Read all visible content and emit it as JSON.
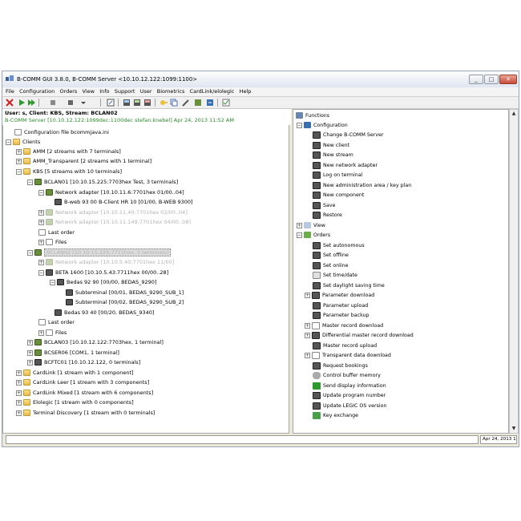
{
  "window": {
    "title": "B-COMM GUI 3.8.0, B-COMM Server <10.10.12.122:1099:1100>"
  },
  "menu": [
    "File",
    "Configuration",
    "Orders",
    "View",
    "Info",
    "Support",
    "User",
    "Biometrics",
    "CardLink/elolegic",
    "Help"
  ],
  "status": {
    "line1": "User: s, Client: KBS, Stream: BCLAN02",
    "line2": "B-COMM Server [10.10.12.122:1099dec:1100dec stefan.knebel] Apr 24, 2013 11:52 AM"
  },
  "tree": {
    "config_file": "Configuration file bcommjava.ini",
    "clients": "Clients",
    "amm": "AMM [2 streams with 7 terminals]",
    "amm_t": "AMM_Transparent [2 streams with 1 terminal]",
    "kbs": "KBS [5 streams with 10 terminals]",
    "bclan01": "BCLAN01 [10.10.15.225:7703hex Test, 3 terminals]",
    "netadapter": "Network adapter [10.10.11.6:7701hex 01/00..04]",
    "bweb": "B-web 93 00 B-Client HR 10 [01/00, B-WEB 9300]",
    "netadapter_g1": "Network adapter [10.10.11.40:7701hex 02/00..04]",
    "netadapter_g2": "Network adapter [10.10.11.149:7701hex 04/00..08]",
    "lastorder1": "Last order",
    "files1": "Files",
    "bclan02": "BCLAN02 [10.10.15.225:7711hex, 5 terminals]",
    "netadapter_g3": "Network adapter [10.10.5.40:7701hex 11/00]",
    "beta": "BETA 1600 [10.10.5.43:7711hex 00/00..28]",
    "bedas9290": "Bedas 92 90 [00/00, BEDAS_9290]",
    "sub1": "Subterminal [00/01, BEDAS_9290_SUB_1]",
    "sub2": "Subterminal [00/02, BEDAS_9290_SUB_2]",
    "bedas9340": "Bedas 93 40 [00/20, BEDAS_9340]",
    "lastorder2": "Last order",
    "files2": "Files",
    "bclan03": "BCLAN03 [10.10.12.122:7703hex, 1 terminal]",
    "bcser06": "BCSER06 [COM1, 1 terminal]",
    "bcftc01": "BCFTC01 [10.10.12.122, 0 terminals]",
    "cardlink": "CardLink [1 stream with 1 component]",
    "cardlink_leer": "CardLink Leer [1 stream with 3 components]",
    "cardlink_mixed": "CardLink Mixed [1 stream with 6 components]",
    "elolegic": "Elolegic [1 stream with 0 components]",
    "terminal_discovery": "Terminal Discovery [1 stream with 0 terminals]"
  },
  "functions": {
    "root": "Functions",
    "configuration": "Configuration",
    "config_items": [
      "Change B-COMM Server",
      "New client",
      "New stream",
      "New network adapter",
      "Log on terminal",
      "New administration area / key plan",
      "New component",
      "Save",
      "Restore"
    ],
    "view": "View",
    "orders": "Orders",
    "order_items": [
      "Set autonomous",
      "Set offline",
      "Set online",
      "Set time/date",
      "Set daylight saving time",
      "Parameter download",
      "Parameter upload",
      "Parameter backup",
      "Master record download",
      "Differential master record download",
      "Master record upload",
      "Transparent data download",
      "Request bookings",
      "Control buffer memory",
      "Send display information",
      "Update program number",
      "Update LEGIC OS version",
      "Key exchange"
    ]
  },
  "footer": {
    "datetime": "Apr 24, 2013 11:52 AM"
  }
}
